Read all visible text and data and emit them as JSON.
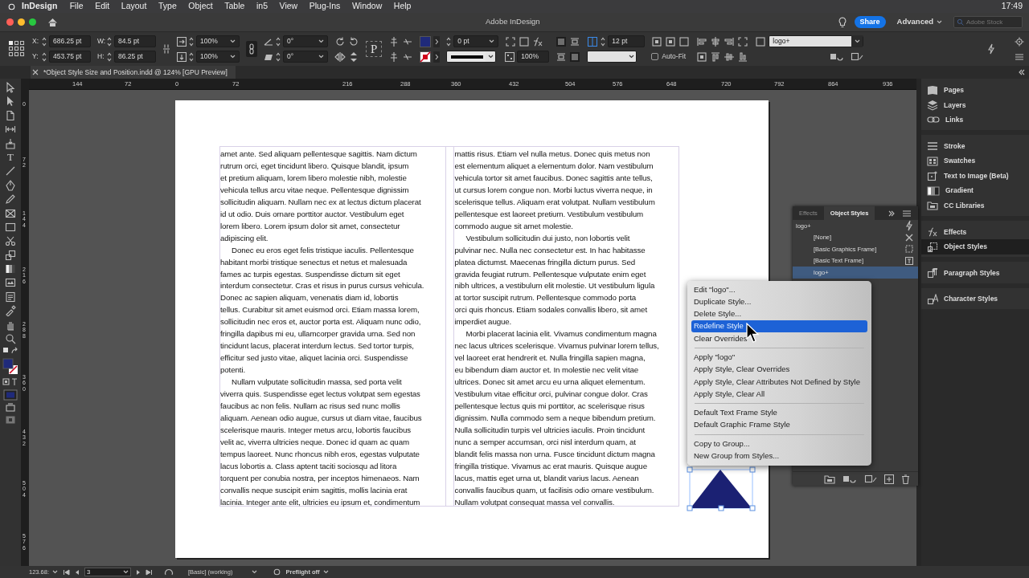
{
  "menu_bar": {
    "app": "InDesign",
    "items": [
      "File",
      "Edit",
      "Layout",
      "Type",
      "Object",
      "Table",
      "in5",
      "View",
      "Plug-Ins",
      "Window",
      "Help"
    ],
    "clock": "17:49"
  },
  "title_bar": {
    "title": "Adobe InDesign",
    "share": "Share",
    "workspace": "Advanced",
    "search_placeholder": "Adobe Stock"
  },
  "control_panel": {
    "position": [
      {
        "label": "X:",
        "value": "686.25 pt"
      },
      {
        "label": "Y:",
        "value": "453.75 pt"
      }
    ],
    "size": [
      {
        "label": "W:",
        "value": "84.5 pt"
      },
      {
        "label": "H:",
        "value": "86.25 pt"
      }
    ],
    "scale": [
      "100%",
      "100%"
    ],
    "angles": [
      "0°",
      "0°"
    ],
    "frame_glyph": "P",
    "stroke_weight": "0 pt",
    "opacity": "100%",
    "gutter": "12 pt",
    "auto_fit": {
      "label": "Auto-Fit",
      "checked": false
    },
    "object_style": "logo+"
  },
  "document_tab": {
    "title": "*Object Style Size and Position.indd @ 124% [GPU Preview]"
  },
  "toolbox": {
    "type_glyph": "T"
  },
  "horizontal_ruler": [
    "144",
    "72",
    "0",
    "72",
    "216",
    "288",
    "360",
    "432",
    "504",
    "576",
    "648",
    "720",
    "792",
    "864",
    "936"
  ],
  "vertical_ruler": [
    "0",
    "72",
    "144",
    "216",
    "288",
    "360",
    "432",
    "504",
    "576"
  ],
  "text_columns": [
    [
      {
        "first_line_indent": false,
        "lines": [
          "amet ante. Sed aliquam pellentesque sagittis. Nam dictum",
          "rutrum orci, eget tincidunt libero. Quisque blandit, ipsum",
          "et pretium aliquam, lorem libero molestie nibh, molestie",
          "vehicula tellus arcu vitae neque. Pellentesque dignissim",
          "sollicitudin aliquam. Nullam nec ex at lectus dictum placerat",
          "id ut odio. Duis ornare porttitor auctor. Vestibulum eget",
          "lorem libero. Lorem ipsum dolor sit amet, consectetur",
          "adipiscing elit."
        ]
      },
      {
        "first_line_indent": true,
        "lines": [
          "Donec eu eros eget felis tristique iaculis. Pellentesque",
          "habitant morbi tristique senectus et netus et malesuada",
          "fames ac turpis egestas. Suspendisse dictum sit eget",
          "interdum consectetur. Cras et risus in purus cursus vehicula.",
          "Donec ac sapien aliquam, venenatis diam id, lobortis",
          "tellus. Curabitur sit amet euismod orci. Etiam massa lorem,",
          "sollicitudin nec eros et, auctor porta est. Aliquam nunc odio,",
          "fringilla dapibus mi eu, ullamcorper gravida urna. Sed non",
          "tincidunt lacus, placerat interdum lectus. Sed tortor turpis,",
          "efficitur sed justo vitae, aliquet lacinia orci. Suspendisse",
          "potenti."
        ]
      },
      {
        "first_line_indent": true,
        "lines": [
          "Nullam vulputate sollicitudin massa, sed porta velit",
          "viverra quis. Suspendisse eget lectus volutpat sem egestas",
          "faucibus ac non felis. Nullam ac risus sed nunc mollis",
          "aliquam. Aenean odio augue, cursus ut diam vitae, faucibus",
          "scelerisque mauris. Integer metus arcu, lobortis faucibus",
          "velit ac, viverra ultricies neque. Donec id quam ac quam",
          "tempus laoreet. Nunc rhoncus nibh eros, egestas vulputate",
          "lacus lobortis a. Class aptent taciti sociosqu ad litora",
          "torquent per conubia nostra, per inceptos himenaeos. Nam",
          "convallis neque suscipit enim sagittis, mollis lacinia erat",
          "lacinia. Integer ante elit, ultricies eu ipsum et, condimentum"
        ]
      }
    ],
    [
      {
        "first_line_indent": false,
        "lines": [
          "mattis risus. Etiam vel nulla metus. Donec quis metus non",
          "est elementum aliquet a elementum dolor. Nam vestibulum",
          "vehicula tortor sit amet faucibus. Donec sagittis ante tellus,",
          "ut cursus lorem congue non. Morbi luctus viverra neque, in",
          "scelerisque tellus. Aliquam erat volutpat. Nullam vestibulum",
          "pellentesque est laoreet pretium. Vestibulum vestibulum",
          "commodo augue sit amet molestie."
        ]
      },
      {
        "first_line_indent": true,
        "lines": [
          "Vestibulum sollicitudin dui justo, non lobortis velit",
          "pulvinar nec. Nulla nec consectetur est. In hac habitasse",
          "platea dictumst. Maecenas fringilla dictum purus. Sed",
          "gravida feugiat rutrum. Pellentesque vulputate enim eget",
          "nibh ultrices, a vestibulum elit molestie. Ut vestibulum ligula",
          "at tortor suscipit rutrum. Pellentesque commodo porta",
          "orci quis rhoncus. Etiam sodales convallis libero, sit amet",
          "imperdiet augue."
        ]
      },
      {
        "first_line_indent": true,
        "lines": [
          "Morbi placerat lacinia elit. Vivamus condimentum magna",
          "nec lacus ultrices scelerisque. Vivamus pulvinar lorem tellus,",
          "vel laoreet erat hendrerit et. Nulla fringilla sapien magna,",
          "eu bibendum diam auctor et. In molestie nec velit vitae",
          "ultrices. Donec sit amet arcu eu urna aliquet elementum.",
          "Vestibulum vitae efficitur orci, pulvinar congue dolor. Cras",
          "pellentesque lectus quis mi porttitor, ac scelerisque risus",
          "dignissim. Nulla commodo sem a neque bibendum pretium.",
          "Nulla sollicitudin turpis vel ultricies iaculis. Proin tincidunt",
          "nunc a semper accumsan, orci nisl interdum quam, at",
          "blandit felis massa non urna. Fusce tincidunt dictum magna",
          "fringilla tristique. Vivamus ac erat mauris. Quisque augue",
          "lacus, mattis eget urna ut, blandit varius lacus. Aenean",
          "convallis faucibus quam, ut facilisis odio ornare vestibulum.",
          "Nullam volutpat consequat massa vel convallis."
        ]
      }
    ]
  ],
  "object_styles_panel": {
    "tabs": [
      {
        "label": "Effects",
        "selected": false
      },
      {
        "label": "Object Styles",
        "selected": true
      }
    ],
    "current": "logo+",
    "styles": [
      {
        "label": "[None]",
        "kind": "none",
        "selected": false
      },
      {
        "label": "[Basic Graphics Frame]",
        "kind": "graphics",
        "selected": false
      },
      {
        "label": "[Basic Text Frame]",
        "kind": "text",
        "selected": false
      },
      {
        "label": "logo+",
        "kind": "custom",
        "selected": true
      }
    ]
  },
  "context_menu": [
    [
      {
        "label": "Edit \"logo\"...",
        "selected": false
      },
      {
        "label": "Duplicate Style...",
        "selected": false
      },
      {
        "label": "Delete Style...",
        "selected": false
      },
      {
        "label": "Redefine Style",
        "selected": true
      },
      {
        "label": "Clear Overrides",
        "selected": false
      }
    ],
    [
      {
        "label": "Apply \"logo\"",
        "selected": false
      },
      {
        "label": "Apply Style, Clear Overrides",
        "selected": false
      },
      {
        "label": "Apply Style, Clear Attributes Not Defined by Style",
        "selected": false
      },
      {
        "label": "Apply Style, Clear All",
        "selected": false
      }
    ],
    [
      {
        "label": "Default Text Frame Style",
        "selected": false
      },
      {
        "label": "Default Graphic Frame Style",
        "selected": false
      }
    ],
    [
      {
        "label": "Copy to Group...",
        "selected": false
      },
      {
        "label": "New Group from Styles...",
        "selected": false
      }
    ]
  ],
  "panel_dock": [
    [
      {
        "label": "Pages",
        "selected": false
      },
      {
        "label": "Layers",
        "selected": false
      },
      {
        "label": "Links",
        "selected": false
      }
    ],
    [
      {
        "label": "Stroke",
        "selected": false
      },
      {
        "label": "Swatches",
        "selected": false
      },
      {
        "label": "Text to Image (Beta)",
        "selected": false
      },
      {
        "label": "Gradient",
        "selected": false
      },
      {
        "label": "CC Libraries",
        "selected": false
      }
    ],
    [
      {
        "label": "Effects",
        "selected": false
      },
      {
        "label": "Object Styles",
        "selected": true
      }
    ],
    [
      {
        "label": "Paragraph Styles",
        "selected": false
      }
    ],
    [
      {
        "label": "Character Styles",
        "selected": false
      }
    ]
  ],
  "status_bar": {
    "zoom": "123.68:",
    "page": "3",
    "style": "[Basic] (working)",
    "preflight": "Preflight off"
  }
}
